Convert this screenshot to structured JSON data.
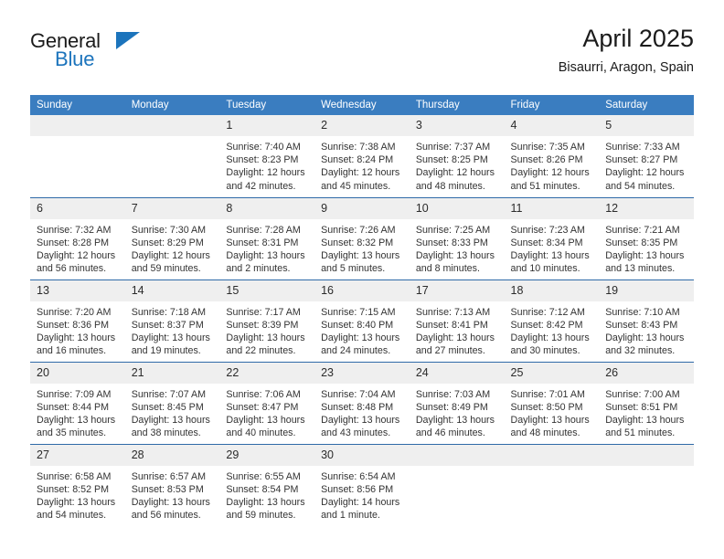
{
  "brand": {
    "name_part1": "General",
    "name_part2": "Blue",
    "accent_color": "#1c74bc"
  },
  "header": {
    "title": "April 2025",
    "subtitle": "Bisaurri, Aragon, Spain"
  },
  "calendar": {
    "header_bg": "#3a7dc0",
    "daynum_bg": "#efefef",
    "row_separator_color": "#2f6aa8",
    "weekdays": [
      "Sunday",
      "Monday",
      "Tuesday",
      "Wednesday",
      "Thursday",
      "Friday",
      "Saturday"
    ],
    "weeks": [
      [
        {
          "day": "",
          "lines": []
        },
        {
          "day": "",
          "lines": []
        },
        {
          "day": "1",
          "lines": [
            "Sunrise: 7:40 AM",
            "Sunset: 8:23 PM",
            "Daylight: 12 hours",
            "and 42 minutes."
          ]
        },
        {
          "day": "2",
          "lines": [
            "Sunrise: 7:38 AM",
            "Sunset: 8:24 PM",
            "Daylight: 12 hours",
            "and 45 minutes."
          ]
        },
        {
          "day": "3",
          "lines": [
            "Sunrise: 7:37 AM",
            "Sunset: 8:25 PM",
            "Daylight: 12 hours",
            "and 48 minutes."
          ]
        },
        {
          "day": "4",
          "lines": [
            "Sunrise: 7:35 AM",
            "Sunset: 8:26 PM",
            "Daylight: 12 hours",
            "and 51 minutes."
          ]
        },
        {
          "day": "5",
          "lines": [
            "Sunrise: 7:33 AM",
            "Sunset: 8:27 PM",
            "Daylight: 12 hours",
            "and 54 minutes."
          ]
        }
      ],
      [
        {
          "day": "6",
          "lines": [
            "Sunrise: 7:32 AM",
            "Sunset: 8:28 PM",
            "Daylight: 12 hours",
            "and 56 minutes."
          ]
        },
        {
          "day": "7",
          "lines": [
            "Sunrise: 7:30 AM",
            "Sunset: 8:29 PM",
            "Daylight: 12 hours",
            "and 59 minutes."
          ]
        },
        {
          "day": "8",
          "lines": [
            "Sunrise: 7:28 AM",
            "Sunset: 8:31 PM",
            "Daylight: 13 hours",
            "and 2 minutes."
          ]
        },
        {
          "day": "9",
          "lines": [
            "Sunrise: 7:26 AM",
            "Sunset: 8:32 PM",
            "Daylight: 13 hours",
            "and 5 minutes."
          ]
        },
        {
          "day": "10",
          "lines": [
            "Sunrise: 7:25 AM",
            "Sunset: 8:33 PM",
            "Daylight: 13 hours",
            "and 8 minutes."
          ]
        },
        {
          "day": "11",
          "lines": [
            "Sunrise: 7:23 AM",
            "Sunset: 8:34 PM",
            "Daylight: 13 hours",
            "and 10 minutes."
          ]
        },
        {
          "day": "12",
          "lines": [
            "Sunrise: 7:21 AM",
            "Sunset: 8:35 PM",
            "Daylight: 13 hours",
            "and 13 minutes."
          ]
        }
      ],
      [
        {
          "day": "13",
          "lines": [
            "Sunrise: 7:20 AM",
            "Sunset: 8:36 PM",
            "Daylight: 13 hours",
            "and 16 minutes."
          ]
        },
        {
          "day": "14",
          "lines": [
            "Sunrise: 7:18 AM",
            "Sunset: 8:37 PM",
            "Daylight: 13 hours",
            "and 19 minutes."
          ]
        },
        {
          "day": "15",
          "lines": [
            "Sunrise: 7:17 AM",
            "Sunset: 8:39 PM",
            "Daylight: 13 hours",
            "and 22 minutes."
          ]
        },
        {
          "day": "16",
          "lines": [
            "Sunrise: 7:15 AM",
            "Sunset: 8:40 PM",
            "Daylight: 13 hours",
            "and 24 minutes."
          ]
        },
        {
          "day": "17",
          "lines": [
            "Sunrise: 7:13 AM",
            "Sunset: 8:41 PM",
            "Daylight: 13 hours",
            "and 27 minutes."
          ]
        },
        {
          "day": "18",
          "lines": [
            "Sunrise: 7:12 AM",
            "Sunset: 8:42 PM",
            "Daylight: 13 hours",
            "and 30 minutes."
          ]
        },
        {
          "day": "19",
          "lines": [
            "Sunrise: 7:10 AM",
            "Sunset: 8:43 PM",
            "Daylight: 13 hours",
            "and 32 minutes."
          ]
        }
      ],
      [
        {
          "day": "20",
          "lines": [
            "Sunrise: 7:09 AM",
            "Sunset: 8:44 PM",
            "Daylight: 13 hours",
            "and 35 minutes."
          ]
        },
        {
          "day": "21",
          "lines": [
            "Sunrise: 7:07 AM",
            "Sunset: 8:45 PM",
            "Daylight: 13 hours",
            "and 38 minutes."
          ]
        },
        {
          "day": "22",
          "lines": [
            "Sunrise: 7:06 AM",
            "Sunset: 8:47 PM",
            "Daylight: 13 hours",
            "and 40 minutes."
          ]
        },
        {
          "day": "23",
          "lines": [
            "Sunrise: 7:04 AM",
            "Sunset: 8:48 PM",
            "Daylight: 13 hours",
            "and 43 minutes."
          ]
        },
        {
          "day": "24",
          "lines": [
            "Sunrise: 7:03 AM",
            "Sunset: 8:49 PM",
            "Daylight: 13 hours",
            "and 46 minutes."
          ]
        },
        {
          "day": "25",
          "lines": [
            "Sunrise: 7:01 AM",
            "Sunset: 8:50 PM",
            "Daylight: 13 hours",
            "and 48 minutes."
          ]
        },
        {
          "day": "26",
          "lines": [
            "Sunrise: 7:00 AM",
            "Sunset: 8:51 PM",
            "Daylight: 13 hours",
            "and 51 minutes."
          ]
        }
      ],
      [
        {
          "day": "27",
          "lines": [
            "Sunrise: 6:58 AM",
            "Sunset: 8:52 PM",
            "Daylight: 13 hours",
            "and 54 minutes."
          ]
        },
        {
          "day": "28",
          "lines": [
            "Sunrise: 6:57 AM",
            "Sunset: 8:53 PM",
            "Daylight: 13 hours",
            "and 56 minutes."
          ]
        },
        {
          "day": "29",
          "lines": [
            "Sunrise: 6:55 AM",
            "Sunset: 8:54 PM",
            "Daylight: 13 hours",
            "and 59 minutes."
          ]
        },
        {
          "day": "30",
          "lines": [
            "Sunrise: 6:54 AM",
            "Sunset: 8:56 PM",
            "Daylight: 14 hours",
            "and 1 minute."
          ]
        },
        {
          "day": "",
          "lines": []
        },
        {
          "day": "",
          "lines": []
        },
        {
          "day": "",
          "lines": []
        }
      ]
    ]
  }
}
